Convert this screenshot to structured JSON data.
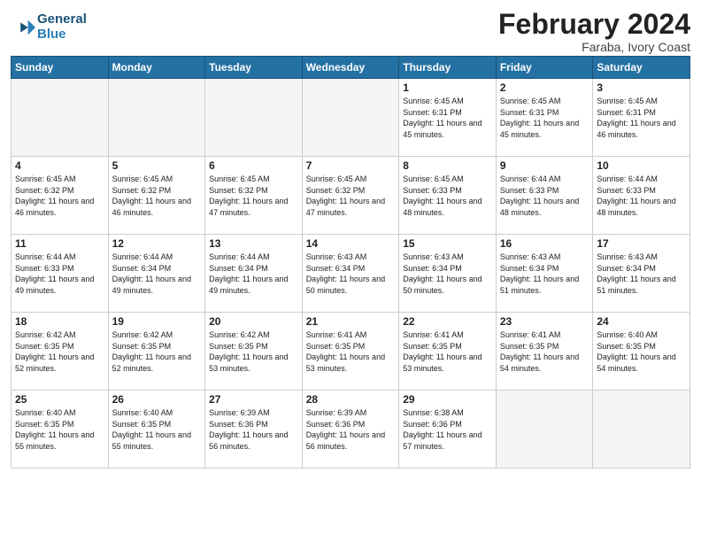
{
  "header": {
    "title": "February 2024",
    "subtitle": "Faraba, Ivory Coast",
    "logo_line1": "General",
    "logo_line2": "Blue"
  },
  "days_of_week": [
    "Sunday",
    "Monday",
    "Tuesday",
    "Wednesday",
    "Thursday",
    "Friday",
    "Saturday"
  ],
  "weeks": [
    [
      {
        "day": "",
        "empty": true
      },
      {
        "day": "",
        "empty": true
      },
      {
        "day": "",
        "empty": true
      },
      {
        "day": "",
        "empty": true
      },
      {
        "day": "1",
        "sunrise": "6:45 AM",
        "sunset": "6:31 PM",
        "daylight": "11 hours and 45 minutes."
      },
      {
        "day": "2",
        "sunrise": "6:45 AM",
        "sunset": "6:31 PM",
        "daylight": "11 hours and 45 minutes."
      },
      {
        "day": "3",
        "sunrise": "6:45 AM",
        "sunset": "6:31 PM",
        "daylight": "11 hours and 46 minutes."
      }
    ],
    [
      {
        "day": "4",
        "sunrise": "6:45 AM",
        "sunset": "6:32 PM",
        "daylight": "11 hours and 46 minutes."
      },
      {
        "day": "5",
        "sunrise": "6:45 AM",
        "sunset": "6:32 PM",
        "daylight": "11 hours and 46 minutes."
      },
      {
        "day": "6",
        "sunrise": "6:45 AM",
        "sunset": "6:32 PM",
        "daylight": "11 hours and 47 minutes."
      },
      {
        "day": "7",
        "sunrise": "6:45 AM",
        "sunset": "6:32 PM",
        "daylight": "11 hours and 47 minutes."
      },
      {
        "day": "8",
        "sunrise": "6:45 AM",
        "sunset": "6:33 PM",
        "daylight": "11 hours and 48 minutes."
      },
      {
        "day": "9",
        "sunrise": "6:44 AM",
        "sunset": "6:33 PM",
        "daylight": "11 hours and 48 minutes."
      },
      {
        "day": "10",
        "sunrise": "6:44 AM",
        "sunset": "6:33 PM",
        "daylight": "11 hours and 48 minutes."
      }
    ],
    [
      {
        "day": "11",
        "sunrise": "6:44 AM",
        "sunset": "6:33 PM",
        "daylight": "11 hours and 49 minutes."
      },
      {
        "day": "12",
        "sunrise": "6:44 AM",
        "sunset": "6:34 PM",
        "daylight": "11 hours and 49 minutes."
      },
      {
        "day": "13",
        "sunrise": "6:44 AM",
        "sunset": "6:34 PM",
        "daylight": "11 hours and 49 minutes."
      },
      {
        "day": "14",
        "sunrise": "6:43 AM",
        "sunset": "6:34 PM",
        "daylight": "11 hours and 50 minutes."
      },
      {
        "day": "15",
        "sunrise": "6:43 AM",
        "sunset": "6:34 PM",
        "daylight": "11 hours and 50 minutes."
      },
      {
        "day": "16",
        "sunrise": "6:43 AM",
        "sunset": "6:34 PM",
        "daylight": "11 hours and 51 minutes."
      },
      {
        "day": "17",
        "sunrise": "6:43 AM",
        "sunset": "6:34 PM",
        "daylight": "11 hours and 51 minutes."
      }
    ],
    [
      {
        "day": "18",
        "sunrise": "6:42 AM",
        "sunset": "6:35 PM",
        "daylight": "11 hours and 52 minutes."
      },
      {
        "day": "19",
        "sunrise": "6:42 AM",
        "sunset": "6:35 PM",
        "daylight": "11 hours and 52 minutes."
      },
      {
        "day": "20",
        "sunrise": "6:42 AM",
        "sunset": "6:35 PM",
        "daylight": "11 hours and 53 minutes."
      },
      {
        "day": "21",
        "sunrise": "6:41 AM",
        "sunset": "6:35 PM",
        "daylight": "11 hours and 53 minutes."
      },
      {
        "day": "22",
        "sunrise": "6:41 AM",
        "sunset": "6:35 PM",
        "daylight": "11 hours and 53 minutes."
      },
      {
        "day": "23",
        "sunrise": "6:41 AM",
        "sunset": "6:35 PM",
        "daylight": "11 hours and 54 minutes."
      },
      {
        "day": "24",
        "sunrise": "6:40 AM",
        "sunset": "6:35 PM",
        "daylight": "11 hours and 54 minutes."
      }
    ],
    [
      {
        "day": "25",
        "sunrise": "6:40 AM",
        "sunset": "6:35 PM",
        "daylight": "11 hours and 55 minutes."
      },
      {
        "day": "26",
        "sunrise": "6:40 AM",
        "sunset": "6:35 PM",
        "daylight": "11 hours and 55 minutes."
      },
      {
        "day": "27",
        "sunrise": "6:39 AM",
        "sunset": "6:36 PM",
        "daylight": "11 hours and 56 minutes."
      },
      {
        "day": "28",
        "sunrise": "6:39 AM",
        "sunset": "6:36 PM",
        "daylight": "11 hours and 56 minutes."
      },
      {
        "day": "29",
        "sunrise": "6:38 AM",
        "sunset": "6:36 PM",
        "daylight": "11 hours and 57 minutes."
      },
      {
        "day": "",
        "empty": true
      },
      {
        "day": "",
        "empty": true
      }
    ]
  ]
}
